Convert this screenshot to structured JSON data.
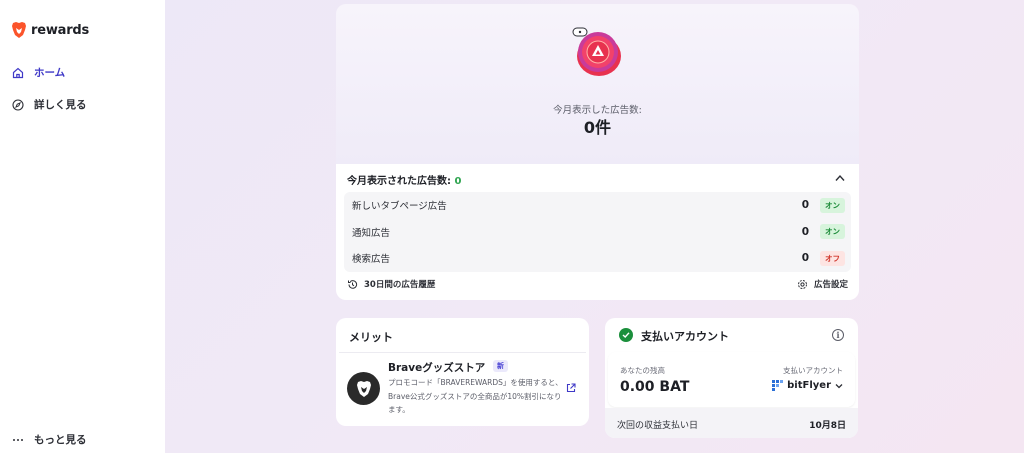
{
  "sidebar": {
    "brand": "rewards",
    "items": [
      {
        "label": "ホーム",
        "active": true
      },
      {
        "label": "詳しく見る",
        "active": false
      }
    ],
    "more_label": "もっと見る"
  },
  "hero": {
    "label": "今月表示した広告数:",
    "value": "0件"
  },
  "ads": {
    "header_label": "今月表示された広告数:",
    "header_count": "0",
    "rows": [
      {
        "label": "新しいタブページ広告",
        "value": "0",
        "status": "オン"
      },
      {
        "label": "通知広告",
        "value": "0",
        "status": "オン"
      },
      {
        "label": "検索広告",
        "value": "0",
        "status": "オフ"
      }
    ],
    "history_label": "30日間の広告履歴",
    "settings_label": "広告設定"
  },
  "merit": {
    "title": "メリット",
    "item_name": "Braveグッズストア",
    "new_badge": "新",
    "item_description": "プロモコード「BRAVEREWARDS」を使用すると、Brave公式グッズストアの全商品が10%割引になります。"
  },
  "payment": {
    "title": "支払いアカウント",
    "balance_label": "あなたの残高",
    "balance_value": "0.00 BAT",
    "account_label": "支払いアカウント",
    "account_name": "bitFlyer",
    "next_payout_label": "次回の収益支払い日",
    "next_payout_date": "10月8日"
  },
  "colors": {
    "accent": "#3f39c7",
    "on_badge": "#1a8a37",
    "off_badge": "#d0352b",
    "brave_orange": "#fb542b"
  }
}
